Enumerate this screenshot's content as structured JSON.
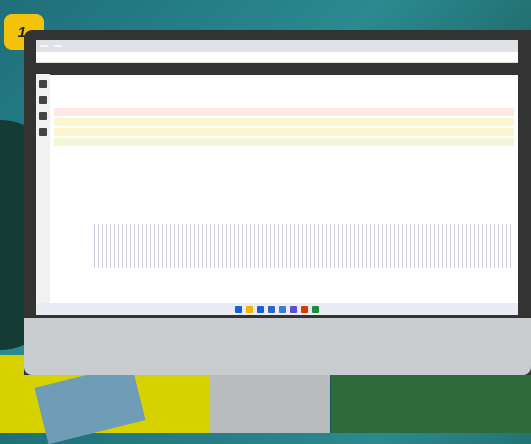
{
  "badge": {
    "label": "1."
  },
  "browser": {
    "tabs": [
      "",
      ""
    ],
    "address": ""
  },
  "app": {
    "title": ""
  },
  "nav": [
    "",
    "",
    "",
    "",
    ""
  ],
  "bands": [
    {
      "color": "#fde7e7",
      "label": ""
    },
    {
      "color": "#fdf7cf",
      "label": ""
    },
    {
      "color": "#fdf7cf",
      "label": ""
    },
    {
      "color": "#f2f7d8",
      "label": ""
    }
  ],
  "taskbar_icons": [
    "#1a5fd6",
    "#f6b400",
    "#1a5fd6",
    "#2a66c8",
    "#3a7bd5",
    "#5a4fcf",
    "#d83b01",
    "#1e8e3e"
  ]
}
